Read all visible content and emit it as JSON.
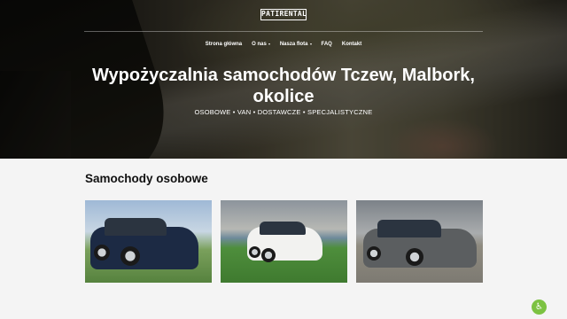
{
  "brand": {
    "logo_text": "PATIRENTAL"
  },
  "nav": {
    "items": [
      {
        "label": "Strona główna",
        "dropdown": false
      },
      {
        "label": "O nas",
        "dropdown": true
      },
      {
        "label": "Nasza flota",
        "dropdown": true
      },
      {
        "label": "FAQ",
        "dropdown": false
      },
      {
        "label": "Kontakt",
        "dropdown": false
      }
    ]
  },
  "hero": {
    "title": "Wypożyczalnia samochodów Tczew, Malbork, okolice",
    "subtitle": "OSOBOWE • VAN • DOSTAWCZE • SPECJALISTYCZNE"
  },
  "section": {
    "title": "Samochody osobowe"
  },
  "cars": [
    {
      "color": "#1c2a44"
    },
    {
      "color": "#f2f2f0"
    },
    {
      "color": "#5b5e60"
    }
  ],
  "widget": {
    "icon": "accessibility-icon"
  }
}
